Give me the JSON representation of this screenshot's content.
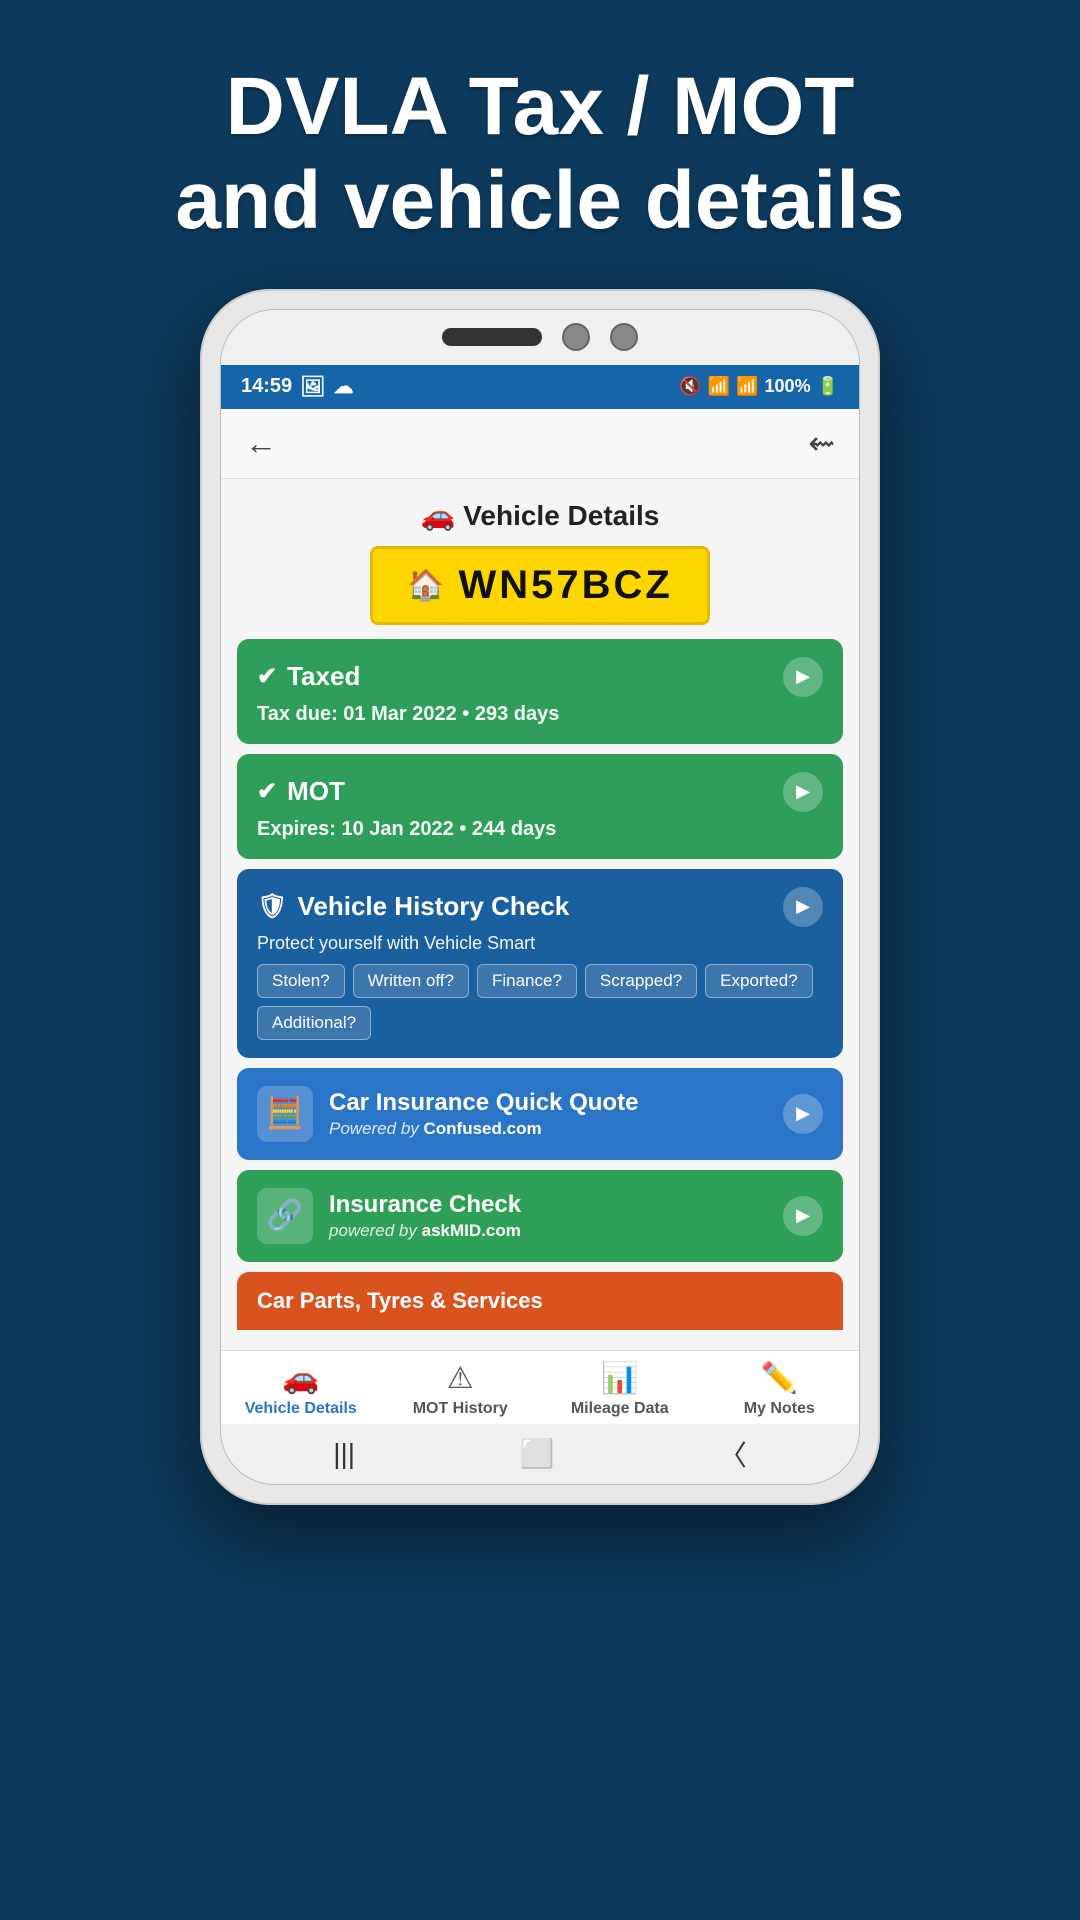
{
  "page": {
    "header_line1": "DVLA Tax / MOT",
    "header_line2": "and vehicle details"
  },
  "status_bar": {
    "time": "14:59",
    "battery": "100%"
  },
  "app": {
    "title": "Vehicle Details",
    "plate": "WN57BCZ"
  },
  "cards": {
    "taxed": {
      "title": "Taxed",
      "sub": "Tax due: 01 Mar 2022 • 293 days"
    },
    "mot": {
      "title": "MOT",
      "sub": "Expires: 10 Jan 2022 • 244 days"
    },
    "history": {
      "title": "Vehicle History Check",
      "sub": "Protect yourself with Vehicle Smart",
      "tags": [
        "Stolen?",
        "Written off?",
        "Finance?",
        "Scrapped?",
        "Exported?",
        "Additional?"
      ]
    },
    "insurance_quote": {
      "title": "Car Insurance Quick Quote",
      "sub_prefix": "Powered by",
      "sub_brand": "Confused.com"
    },
    "insurance_check": {
      "title": "Insurance Check",
      "sub_prefix": "powered by",
      "sub_brand": "askMID.com"
    },
    "parts": {
      "title": "Car Parts, Tyres & Services"
    }
  },
  "bottom_nav": {
    "items": [
      {
        "label": "Vehicle Details",
        "icon": "🚗",
        "active": true
      },
      {
        "label": "MOT History",
        "icon": "⚠",
        "active": false
      },
      {
        "label": "Mileage Data",
        "icon": "📊",
        "active": false
      },
      {
        "label": "My Notes",
        "icon": "✏️",
        "active": false
      }
    ]
  }
}
